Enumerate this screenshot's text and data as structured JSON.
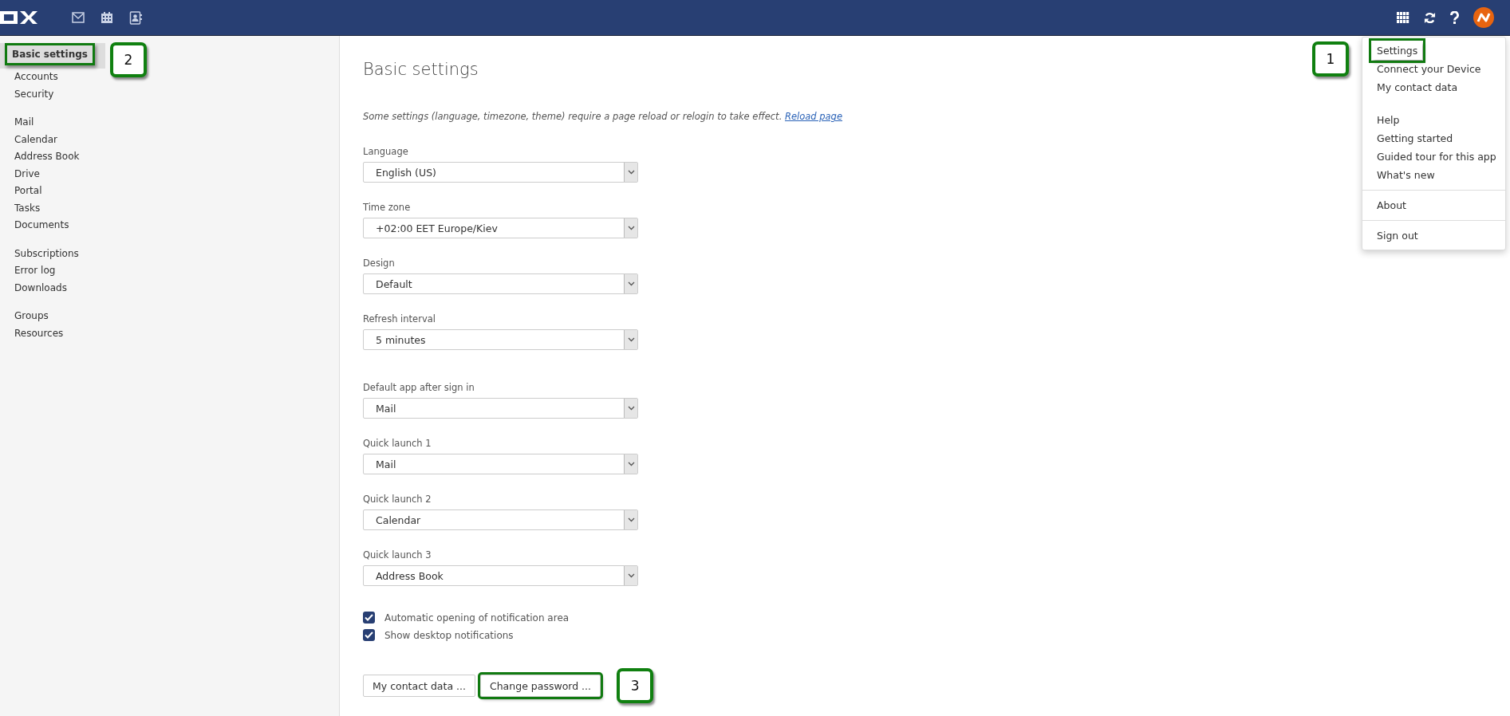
{
  "sidebar": {
    "groups": [
      {
        "items": [
          {
            "label": "Basic settings",
            "selected": true,
            "highlighted": true,
            "callout": "2"
          },
          {
            "label": "Accounts",
            "selected": false
          },
          {
            "label": "Security",
            "selected": false
          }
        ]
      },
      {
        "items": [
          {
            "label": "Mail",
            "selected": false
          },
          {
            "label": "Calendar",
            "selected": false
          },
          {
            "label": "Address Book",
            "selected": false
          },
          {
            "label": "Drive",
            "selected": false
          },
          {
            "label": "Portal",
            "selected": false
          },
          {
            "label": "Tasks",
            "selected": false
          },
          {
            "label": "Documents",
            "selected": false
          }
        ]
      },
      {
        "items": [
          {
            "label": "Subscriptions",
            "selected": false
          },
          {
            "label": "Error log",
            "selected": false
          },
          {
            "label": "Downloads",
            "selected": false
          }
        ]
      },
      {
        "items": [
          {
            "label": "Groups",
            "selected": false
          },
          {
            "label": "Resources",
            "selected": false
          }
        ]
      }
    ]
  },
  "main": {
    "title": "Basic settings",
    "note": "Some settings (language, timezone, theme) require a page reload or relogin to take effect.",
    "note_link": "Reload page",
    "field_groups": [
      [
        {
          "label": "Language",
          "value": "English (US)"
        },
        {
          "label": "Time zone",
          "value": "+02:00 EET Europe/Kiev"
        },
        {
          "label": "Design",
          "value": "Default"
        },
        {
          "label": "Refresh interval",
          "value": "5 minutes"
        }
      ],
      [
        {
          "label": "Default app after sign in",
          "value": "Mail"
        },
        {
          "label": "Quick launch 1",
          "value": "Mail"
        },
        {
          "label": "Quick launch 2",
          "value": "Calendar"
        },
        {
          "label": "Quick launch 3",
          "value": "Address Book"
        }
      ]
    ],
    "checkboxes": [
      {
        "label": "Automatic opening of notification area",
        "checked": true
      },
      {
        "label": "Show desktop notifications",
        "checked": true
      }
    ],
    "buttons": [
      {
        "label": "My contact data ...",
        "highlighted": false
      },
      {
        "label": "Change password ...",
        "highlighted": true,
        "callout": "3"
      }
    ]
  },
  "user_menu": {
    "groups": [
      {
        "divider_above": false,
        "items": [
          {
            "label": "Settings",
            "highlighted": true,
            "callout": "1"
          },
          {
            "label": "Connect your Device",
            "highlighted": false
          },
          {
            "label": "My contact data",
            "highlighted": false
          }
        ]
      },
      {
        "divider_above": false,
        "items": [
          {
            "label": "Help",
            "highlighted": false
          },
          {
            "label": "Getting started",
            "highlighted": false
          },
          {
            "label": "Guided tour for this app",
            "highlighted": false
          },
          {
            "label": "What's new",
            "highlighted": false
          }
        ]
      },
      {
        "divider_above": true,
        "items": [
          {
            "label": "About",
            "highlighted": false
          }
        ]
      },
      {
        "divider_above": true,
        "items": [
          {
            "label": "Sign out",
            "highlighted": false
          }
        ]
      }
    ]
  }
}
